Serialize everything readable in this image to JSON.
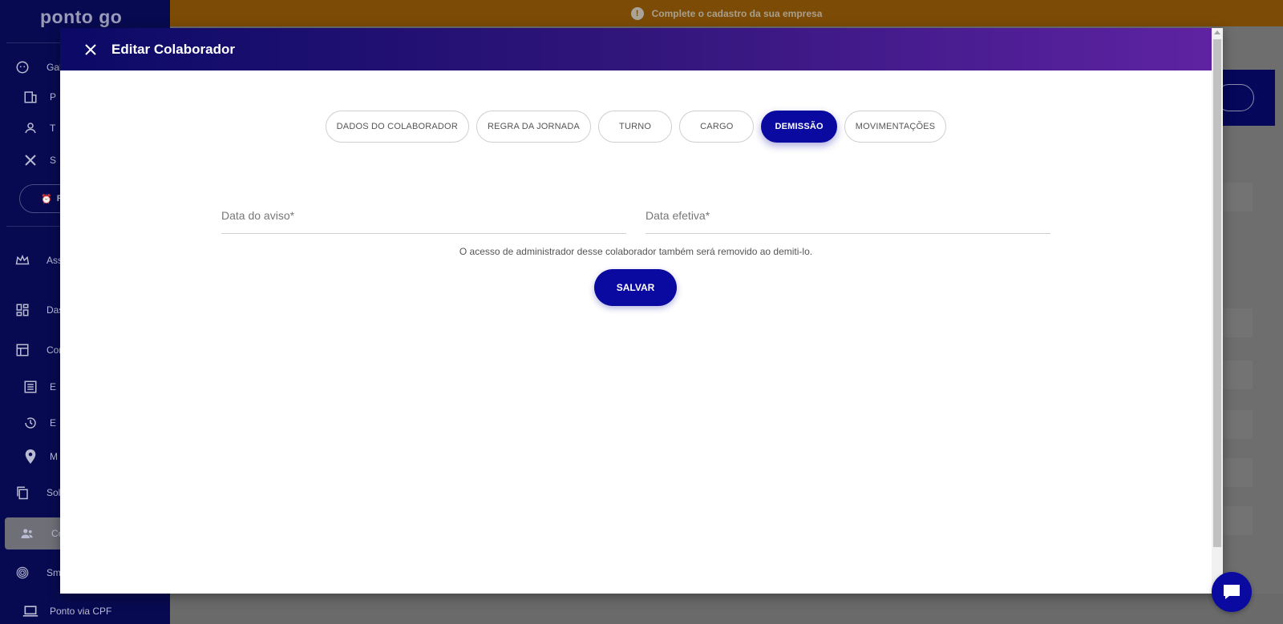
{
  "app": {
    "logo_text": "ponto go"
  },
  "banner": {
    "text": "Complete o cadastro da sua empresa",
    "warn_glyph": "!"
  },
  "sidebar": {
    "items": [
      {
        "label": "Gabr",
        "icon": "face-icon"
      },
      {
        "label": "P",
        "icon": "building-icon"
      },
      {
        "label": "T",
        "icon": "user-switch-icon"
      },
      {
        "label": "S",
        "icon": "close-icon"
      },
      {
        "label": "Ass",
        "icon": "crown-icon"
      },
      {
        "label": "Das",
        "icon": "dashboard-icon"
      },
      {
        "label": "Cor",
        "icon": "calendar-grid-icon"
      },
      {
        "label": "E",
        "icon": "list-icon"
      },
      {
        "label": "E",
        "icon": "history-icon"
      },
      {
        "label": "M",
        "icon": "pin-icon"
      },
      {
        "label": "Sol",
        "icon": "copy-icon"
      },
      {
        "label": "Col",
        "icon": "people-icon"
      },
      {
        "label": "Sm",
        "icon": "fingerprint-icon"
      },
      {
        "label": "Ponto via CPF",
        "icon": "laptop-icon"
      }
    ],
    "pill_label": "R"
  },
  "modal": {
    "title": "Editar Colaborador",
    "tabs": [
      {
        "label": "DADOS DO COLABORADOR",
        "active": false
      },
      {
        "label": "REGRA DA JORNADA",
        "active": false
      },
      {
        "label": "TURNO",
        "active": false
      },
      {
        "label": "CARGO",
        "active": false
      },
      {
        "label": "DEMISSÃO",
        "active": true
      },
      {
        "label": "MOVIMENTAÇÕES",
        "active": false
      }
    ],
    "fields": {
      "notice_date": {
        "placeholder": "Data do aviso*",
        "value": ""
      },
      "effective_date": {
        "placeholder": "Data efetiva*",
        "value": ""
      }
    },
    "notice": "O acesso de administrador desse colaborador também será removido ao demiti-lo.",
    "save_label": "SALVAR"
  },
  "colors": {
    "primary": "#0b0aa0",
    "header_start": "#0b0a66",
    "header_end": "#5e23a2",
    "banner": "#7c4b06",
    "sidebar": "#070a50"
  }
}
